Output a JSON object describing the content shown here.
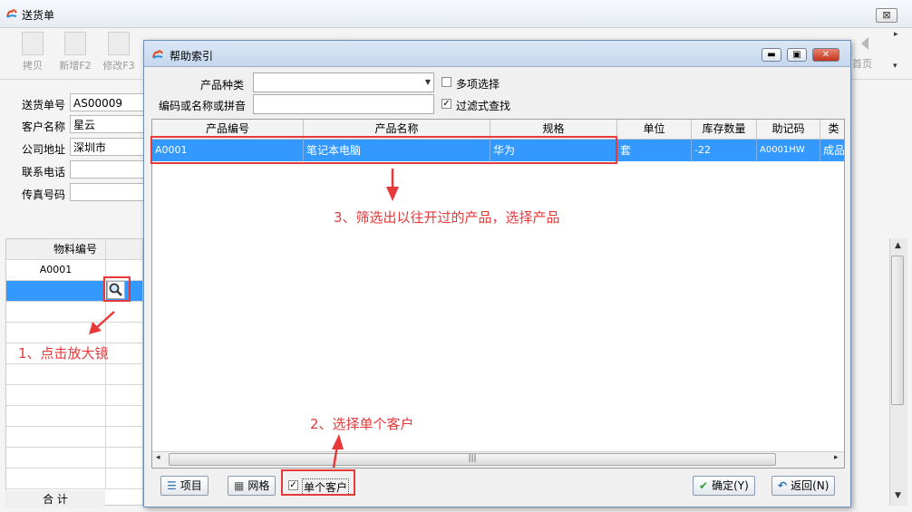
{
  "window": {
    "title": "送货单",
    "close_label": "⊠"
  },
  "toolbar": {
    "items": [
      {
        "label": "拷贝"
      },
      {
        "label": "新增F2"
      },
      {
        "label": "修改F3"
      }
    ],
    "first_label": "首页"
  },
  "form": {
    "fields": [
      {
        "label": "送货单号",
        "value": "AS00009"
      },
      {
        "label": "客户名称",
        "value": "星云"
      },
      {
        "label": "公司地址",
        "value": "深圳市"
      },
      {
        "label": "联系电话",
        "value": ""
      },
      {
        "label": "传真号码",
        "value": ""
      }
    ]
  },
  "left_grid": {
    "header": "物料编号",
    "rows": [
      "A0001"
    ],
    "total_label": "合 计"
  },
  "dialog": {
    "title": "帮助索引",
    "product_type_label": "产品种类",
    "product_type_value": "",
    "multi_select_label": "多项选择",
    "search_label": "编码或名称或拼音",
    "search_value": "",
    "filter_label": "过滤式查找",
    "columns": [
      "产品编号",
      "产品名称",
      "规格",
      "单位",
      "库存数量",
      "助记码",
      "类"
    ],
    "rows": [
      [
        "A0001",
        "笔记本电脑",
        "华为",
        "套",
        "-22",
        "A0001HW",
        "成品"
      ]
    ],
    "buttons": {
      "items": "项目",
      "grid": "网格",
      "single_customer": "单个客户",
      "ok": "确定(Y)",
      "back": "返回(N)"
    }
  },
  "annotations": {
    "step1": "1、点击放大镜",
    "step2": "2、选择单个客户",
    "step3": "3、筛选出以往开过的产品，选择产品"
  },
  "colors": {
    "selection": "#3399ff",
    "annotation": "#e8393a"
  }
}
